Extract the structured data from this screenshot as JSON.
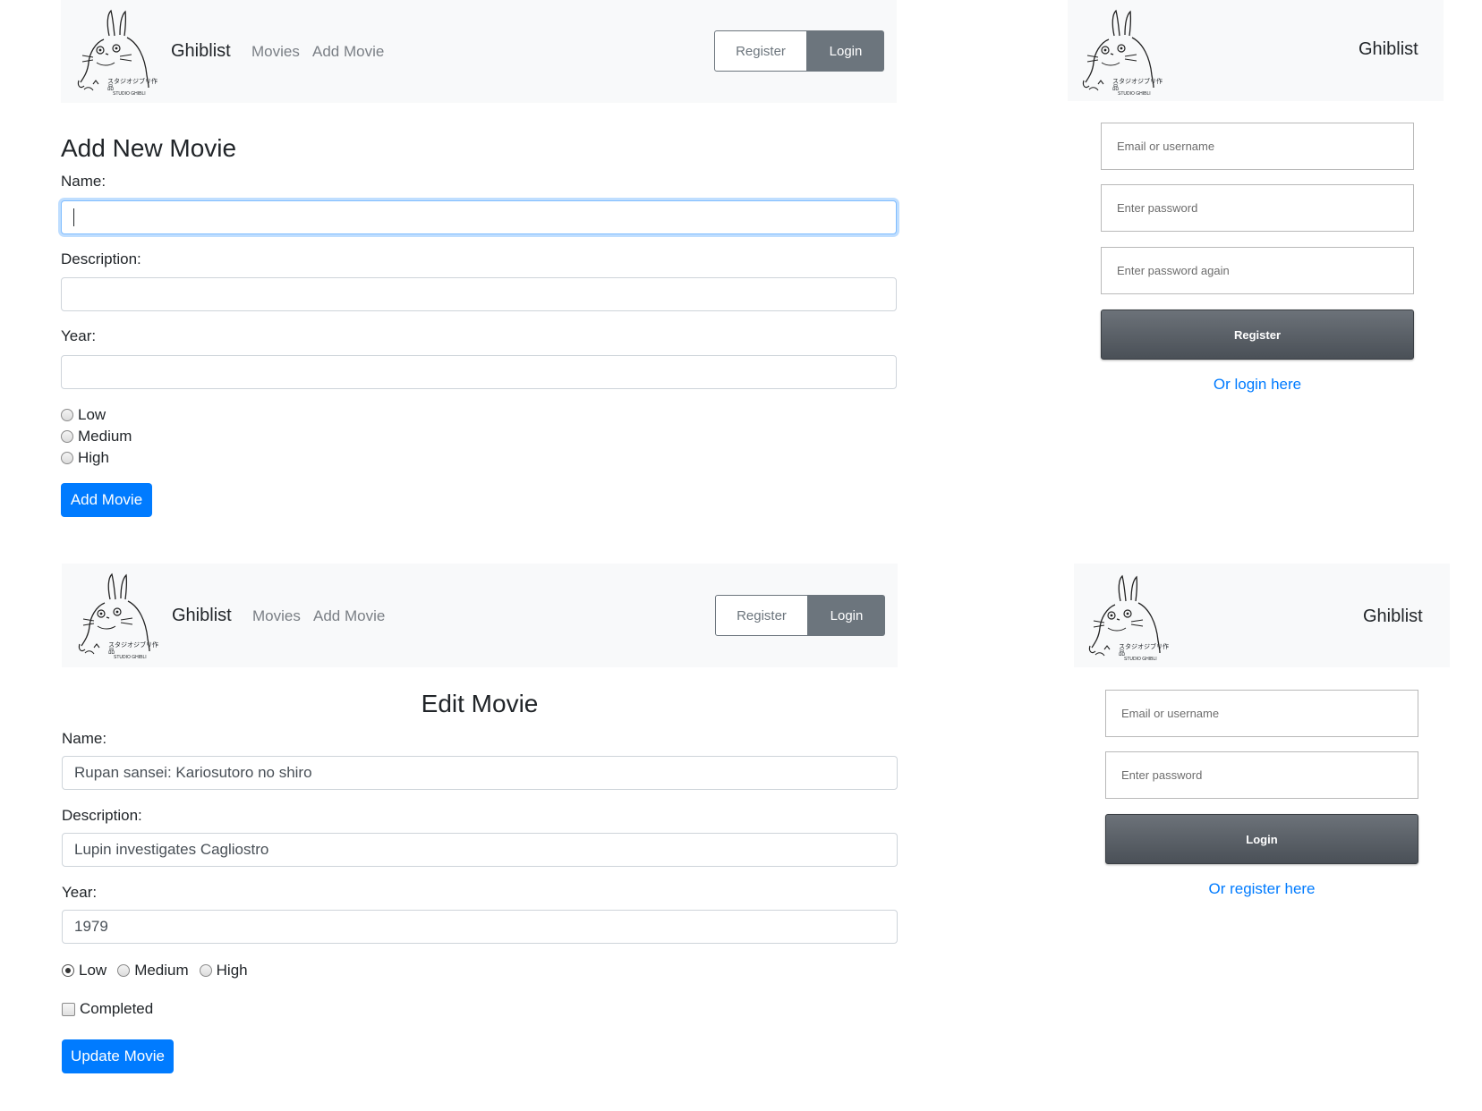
{
  "brand": "Ghiblist",
  "logo": {
    "icon": "totoro-logo-icon",
    "caption_jp": "スタジオジブリ作品",
    "caption_en": "STUDIO GHIBLI"
  },
  "nav": {
    "movies": "Movies",
    "add_movie": "Add Movie",
    "register": "Register",
    "login": "Login"
  },
  "add_form": {
    "title": "Add New Movie",
    "name_label": "Name:",
    "description_label": "Description:",
    "year_label": "Year:",
    "priorities": [
      "Low",
      "Medium",
      "High"
    ],
    "submit": "Add Movie"
  },
  "edit_form": {
    "title": "Edit Movie",
    "name_label": "Name:",
    "name_value": "Rupan sansei: Kariosutoro no shiro",
    "description_label": "Description:",
    "description_value": "Lupin investigates Cagliostro",
    "year_label": "Year:",
    "year_value": "1979",
    "priorities": [
      "Low",
      "Medium",
      "High"
    ],
    "selected_priority": "Low",
    "completed_label": "Completed",
    "submit": "Update Movie"
  },
  "register_form": {
    "email_placeholder": "Email or username",
    "password_placeholder": "Enter password",
    "password_again_placeholder": "Enter password again",
    "submit": "Register",
    "alt_link": "Or login here"
  },
  "login_form": {
    "email_placeholder": "Email or username",
    "password_placeholder": "Enter password",
    "submit": "Login",
    "alt_link": "Or register here"
  },
  "colors": {
    "primary": "#007bff",
    "secondary": "#6c757d",
    "navbar_bg": "#f8f9fa"
  }
}
